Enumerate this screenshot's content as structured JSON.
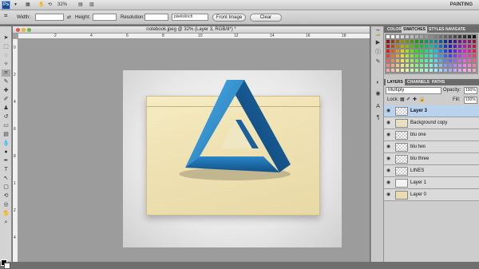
{
  "app": {
    "logo": "Ps",
    "zoom": "32%",
    "workspace": "PAINTING"
  },
  "app_buttons": [
    "▾",
    "▦",
    "✋",
    "⟲",
    "▤",
    "▥"
  ],
  "options": {
    "width_label": "Width:",
    "height_label": "Height:",
    "resolution_label": "Resolution:",
    "units_value": "pixels/inch",
    "front_image_label": "Front Image",
    "clear_label": "Clear"
  },
  "document": {
    "title": "notebook.jpeg @ 32% (Layer 3, RGB/8*) *"
  },
  "ruler": {
    "h": [
      "2",
      "4",
      "6",
      "8",
      "10",
      "12",
      "14",
      "16",
      "18"
    ],
    "v": [
      "0",
      "2",
      "4",
      "6",
      "8",
      "1",
      "2",
      "4"
    ]
  },
  "panels": {
    "top_tabs": [
      "COLOR",
      "SWATCHES",
      "STYLES",
      "NAVIGATE"
    ],
    "layer_tabs": [
      "LAYERS",
      "CHANNELS",
      "PATHS"
    ],
    "blend_mode": "Multiply",
    "opacity_label": "Opacity:",
    "opacity_value": "100%",
    "lock_label": "Lock:",
    "fill_label": "Fill:",
    "fill_value": "100%"
  },
  "layers": [
    {
      "name": "Layer 3",
      "selected": true
    },
    {
      "name": "Background copy",
      "selected": false
    },
    {
      "name": "blu one",
      "selected": false
    },
    {
      "name": "blu two",
      "selected": false
    },
    {
      "name": "blu three",
      "selected": false
    },
    {
      "name": "LINES",
      "selected": false
    },
    {
      "name": "Layer 1",
      "selected": false
    },
    {
      "name": "Layer 0",
      "selected": false
    }
  ],
  "colors": {
    "selected_layer": "#b9d2ee",
    "triangle_light": "#3a9bd8",
    "triangle_dark": "#1c5f9a",
    "paper": "#efe2b3"
  }
}
